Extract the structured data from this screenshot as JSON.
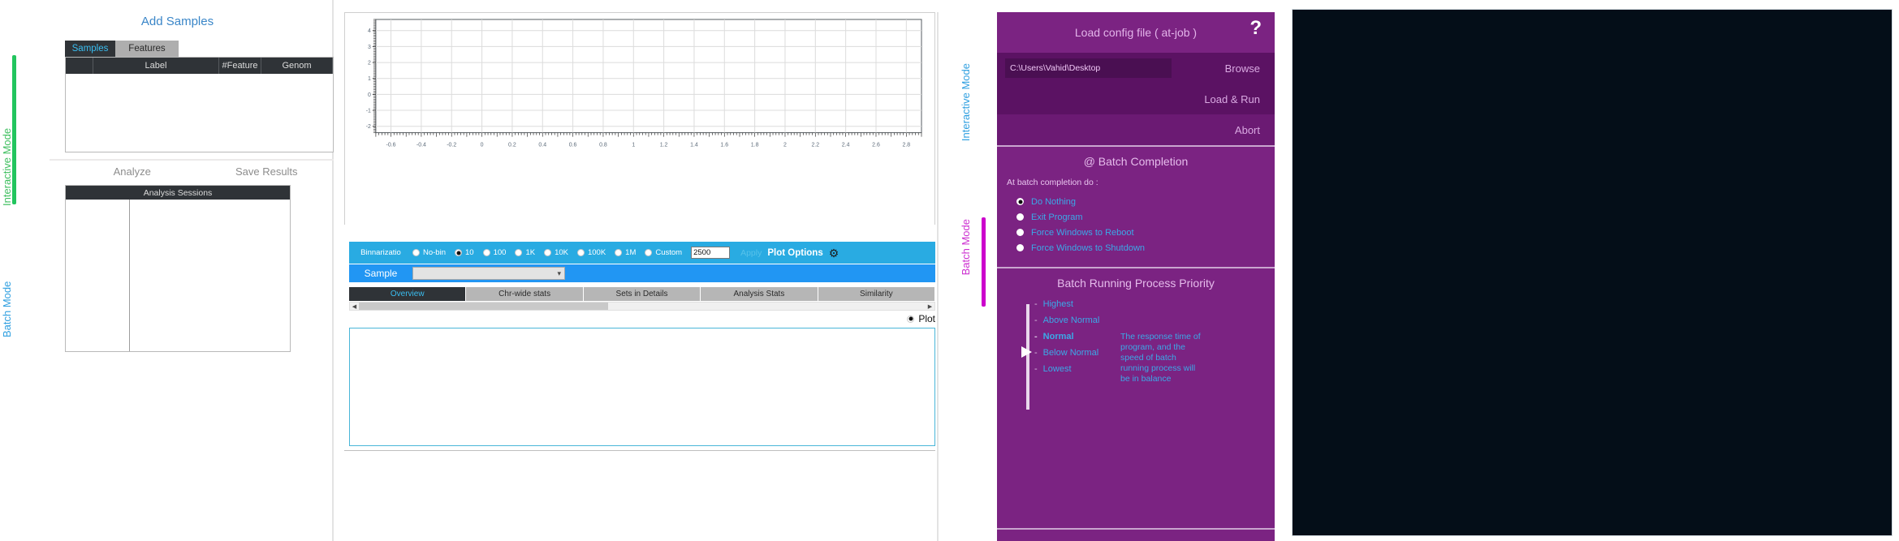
{
  "left_rail": {
    "interactive_mode": "Interactive Mode",
    "batch_mode": "Batch Mode",
    "accent_green": "#22c55e",
    "accent_blue": "#2f9fe0"
  },
  "left_panel": {
    "add_samples": "Add Samples",
    "tabs": [
      {
        "label": "Samples",
        "selected": true
      },
      {
        "label": "Features",
        "selected": false
      }
    ],
    "samples_table": {
      "columns": [
        "",
        "Label",
        "#Feature",
        "Genom"
      ],
      "rows": []
    },
    "actions": [
      {
        "label": "Analyze"
      },
      {
        "label": "Save Results"
      }
    ],
    "sessions_table": {
      "title": "Analysis Sessions",
      "rows": []
    }
  },
  "center": {
    "binarization": {
      "label": "Binnarizatio",
      "options": [
        {
          "label": "No-bin",
          "selected": false
        },
        {
          "label": "10",
          "selected": true
        },
        {
          "label": "100",
          "selected": false
        },
        {
          "label": "1K",
          "selected": false
        },
        {
          "label": "10K",
          "selected": false
        },
        {
          "label": "100K",
          "selected": false
        },
        {
          "label": "1M",
          "selected": false
        },
        {
          "label": "Custom",
          "selected": false
        }
      ],
      "custom_value": "2500",
      "apply_label": "Apply",
      "plot_options_label": "Plot Options",
      "gear_icon": "gear-icon"
    },
    "sample_row": {
      "label": "Sample",
      "value": "",
      "placeholder": ""
    },
    "tabs": [
      {
        "label": "Overview",
        "selected": true
      },
      {
        "label": "Chr-wide stats",
        "selected": false
      },
      {
        "label": "Sets in Details",
        "selected": false
      },
      {
        "label": "Analysis Stats",
        "selected": false
      },
      {
        "label": "Similarity",
        "selected": false
      }
    ],
    "scroll": {
      "left_arrow": "◀",
      "right_arrow": "▶"
    },
    "plot_radio": {
      "label": "Plot",
      "selected": true
    }
  },
  "chart_data": {
    "type": "scatter",
    "title": "",
    "xlabel": "",
    "ylabel": "",
    "xlim": [
      -0.7,
      2.9
    ],
    "ylim": [
      -2.4,
      4.7
    ],
    "xticks": [
      "-0.6",
      "-0.4",
      "-0.2",
      "0",
      "0.2",
      "0.4",
      "0.6",
      "0.8",
      "1",
      "1.2",
      "1.4",
      "1.6",
      "1.8",
      "2",
      "2.2",
      "2.4",
      "2.6",
      "2.8"
    ],
    "xtick_values": [
      -0.6,
      -0.4,
      -0.2,
      0,
      0.2,
      0.4,
      0.6,
      0.8,
      1,
      1.2,
      1.4,
      1.6,
      1.8,
      2,
      2.2,
      2.4,
      2.6,
      2.8
    ],
    "yticks": [
      "4",
      "3",
      "2",
      "1",
      "0",
      "-1",
      "-2"
    ],
    "ytick_values": [
      4,
      3,
      2,
      1,
      0,
      -1,
      -2
    ],
    "grid": true,
    "legend": "none",
    "series": [],
    "values": []
  },
  "right_rail": {
    "interactive_mode": "Interactive Mode",
    "batch_mode": "Batch Mode",
    "accent_magenta": "#cc00cc"
  },
  "batch_panel": {
    "title": "Load config file ( at-job )",
    "help_icon_label": "?",
    "config_path": "C:\\Users\\Vahid\\Desktop",
    "browse_label": "Browse",
    "load_run_label": "Load & Run",
    "abort_label": "Abort",
    "completion": {
      "title": "@ Batch Completion",
      "subtitle": "At batch completion do :",
      "options": [
        {
          "label": "Do Nothing",
          "selected": true
        },
        {
          "label": "Exit Program",
          "selected": false
        },
        {
          "label": "Force Windows to Reboot",
          "selected": false
        },
        {
          "label": "Force Windows to Shutdown",
          "selected": false
        }
      ]
    },
    "priority": {
      "title": "Batch Running Process Priority",
      "levels": [
        {
          "label": "Highest",
          "current": false
        },
        {
          "label": "Above Normal",
          "current": false
        },
        {
          "label": "Normal",
          "current": true
        },
        {
          "label": "Below Normal",
          "current": false
        },
        {
          "label": "Lowest",
          "current": false
        }
      ],
      "description": "The response time of program, and the speed of batch running process will be in balance"
    },
    "colors": {
      "panel": "#7b2382",
      "row": "#5b1263",
      "link": "#3ba9e8"
    }
  },
  "console_panel": {
    "background": "#040e18",
    "content": ""
  }
}
